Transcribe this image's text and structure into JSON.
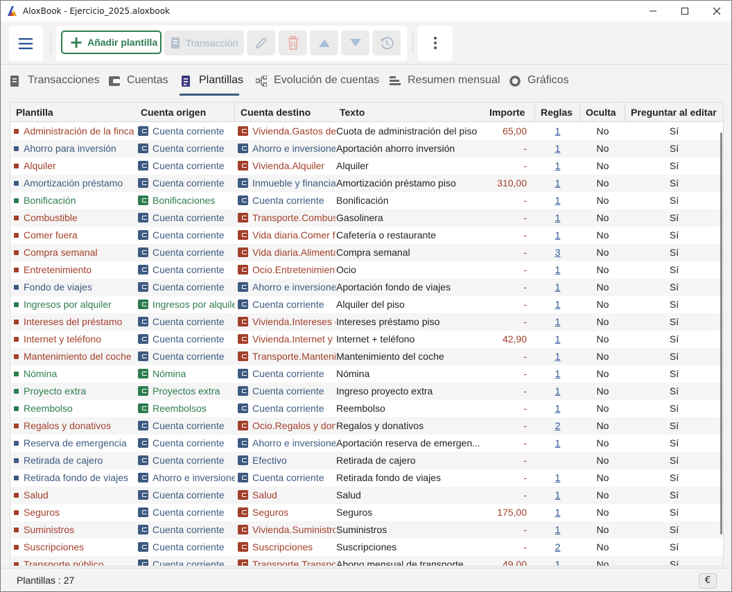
{
  "window": {
    "title": "AloxBook - Ejercicio_2025.aloxbook"
  },
  "toolbar": {
    "add_label": "Añadir plantilla",
    "transaction_label": "Transacción"
  },
  "tabs": [
    {
      "label": "Transacciones",
      "icon": "list-icon"
    },
    {
      "label": "Cuentas",
      "icon": "wallet-icon"
    },
    {
      "label": "Plantillas",
      "icon": "document-icon"
    },
    {
      "label": "Evolución de cuentas",
      "icon": "flow-icon"
    },
    {
      "label": "Resumen mensual",
      "icon": "summary-icon"
    },
    {
      "label": "Gráficos",
      "icon": "circle-icon"
    }
  ],
  "active_tab": "Plantillas",
  "columns": [
    "Plantilla",
    "Cuenta origen",
    "Cuenta destino",
    "Texto",
    "Importe",
    "Reglas",
    "Oculta",
    "Preguntar al editar"
  ],
  "rows": [
    {
      "plantilla": "Administración de la finca",
      "ptype": "red",
      "origen": "Cuenta corriente",
      "otype": "blue",
      "destino": "Vivienda.Gastos de comunidad",
      "dtype": "red",
      "texto": "Cuota de administración del piso",
      "importe": "65,00",
      "reglas": "1",
      "oculta": "No",
      "preguntar": "Sí"
    },
    {
      "plantilla": "Ahorro para inversión",
      "ptype": "blue",
      "origen": "Cuenta corriente",
      "otype": "blue",
      "destino": "Ahorro e inversiones",
      "dtype": "blue",
      "texto": "Aportación ahorro inversión",
      "importe": "-",
      "reglas": "1",
      "oculta": "No",
      "preguntar": "Sí"
    },
    {
      "plantilla": "Alquiler",
      "ptype": "red",
      "origen": "Cuenta corriente",
      "otype": "blue",
      "destino": "Vivienda.Alquiler",
      "dtype": "red",
      "texto": "Alquiler",
      "importe": "-",
      "reglas": "1",
      "oculta": "No",
      "preguntar": "Sí"
    },
    {
      "plantilla": "Amortización préstamo",
      "ptype": "blue",
      "origen": "Cuenta corriente",
      "otype": "blue",
      "destino": "Inmueble y financiación",
      "dtype": "blue",
      "texto": "Amortización préstamo piso",
      "importe": "310,00",
      "reglas": "1",
      "oculta": "No",
      "preguntar": "Sí"
    },
    {
      "plantilla": "Bonificación",
      "ptype": "green",
      "origen": "Bonificaciones",
      "otype": "green",
      "destino": "Cuenta corriente",
      "dtype": "blue",
      "texto": "Bonificación",
      "importe": "-",
      "reglas": "1",
      "oculta": "No",
      "preguntar": "Sí"
    },
    {
      "plantilla": "Combustible",
      "ptype": "red",
      "origen": "Cuenta corriente",
      "otype": "blue",
      "destino": "Transporte.Combustible",
      "dtype": "red",
      "texto": "Gasolinera",
      "importe": "-",
      "reglas": "1",
      "oculta": "No",
      "preguntar": "Sí"
    },
    {
      "plantilla": "Comer fuera",
      "ptype": "red",
      "origen": "Cuenta corriente",
      "otype": "blue",
      "destino": "Vida diaria.Comer fuera",
      "dtype": "red",
      "texto": "Cafetería o restaurante",
      "importe": "-",
      "reglas": "1",
      "oculta": "No",
      "preguntar": "Sí"
    },
    {
      "plantilla": "Compra semanal",
      "ptype": "red",
      "origen": "Cuenta corriente",
      "otype": "blue",
      "destino": "Vida diaria.Alimentación",
      "dtype": "red",
      "texto": "Compra semanal",
      "importe": "-",
      "reglas": "3",
      "oculta": "No",
      "preguntar": "Sí"
    },
    {
      "plantilla": "Entretenimiento",
      "ptype": "red",
      "origen": "Cuenta corriente",
      "otype": "blue",
      "destino": "Ocio.Entretenimiento",
      "dtype": "red",
      "texto": "Ocio",
      "importe": "-",
      "reglas": "1",
      "oculta": "No",
      "preguntar": "Sí"
    },
    {
      "plantilla": "Fondo de viajes",
      "ptype": "blue",
      "origen": "Cuenta corriente",
      "otype": "blue",
      "destino": "Ahorro e inversiones",
      "dtype": "blue",
      "texto": "Aportación fondo de viajes",
      "importe": "-",
      "reglas": "1",
      "oculta": "No",
      "preguntar": "Sí"
    },
    {
      "plantilla": "Ingresos por alquiler",
      "ptype": "green",
      "origen": "Ingresos por alquiler",
      "otype": "green",
      "destino": "Cuenta corriente",
      "dtype": "blue",
      "texto": "Alquiler del piso",
      "importe": "-",
      "reglas": "1",
      "oculta": "No",
      "preguntar": "Sí"
    },
    {
      "plantilla": "Intereses del préstamo",
      "ptype": "red",
      "origen": "Cuenta corriente",
      "otype": "blue",
      "destino": "Vivienda.Intereses del préstamo",
      "dtype": "red",
      "texto": "Intereses préstamo piso",
      "importe": "-",
      "reglas": "1",
      "oculta": "No",
      "preguntar": "Sí"
    },
    {
      "plantilla": "Internet y teléfono",
      "ptype": "red",
      "origen": "Cuenta corriente",
      "otype": "blue",
      "destino": "Vivienda.Internet y teléfono",
      "dtype": "red",
      "texto": "Internet + teléfono",
      "importe": "42,90",
      "reglas": "1",
      "oculta": "No",
      "preguntar": "Sí"
    },
    {
      "plantilla": "Mantenimiento del coche",
      "ptype": "red",
      "origen": "Cuenta corriente",
      "otype": "blue",
      "destino": "Transporte.Mantenimiento",
      "dtype": "red",
      "texto": "Mantenimiento del coche",
      "importe": "-",
      "reglas": "1",
      "oculta": "No",
      "preguntar": "Sí"
    },
    {
      "plantilla": "Nómina",
      "ptype": "green",
      "origen": "Nómina",
      "otype": "green",
      "destino": "Cuenta corriente",
      "dtype": "blue",
      "texto": "Nómina",
      "importe": "-",
      "reglas": "1",
      "oculta": "No",
      "preguntar": "Sí"
    },
    {
      "plantilla": "Proyecto extra",
      "ptype": "green",
      "origen": "Proyectos extra",
      "otype": "green",
      "destino": "Cuenta corriente",
      "dtype": "blue",
      "texto": "Ingreso proyecto extra",
      "importe": "-",
      "reglas": "1",
      "oculta": "No",
      "preguntar": "Sí"
    },
    {
      "plantilla": "Reembolso",
      "ptype": "green",
      "origen": "Reembolsos",
      "otype": "green",
      "destino": "Cuenta corriente",
      "dtype": "blue",
      "texto": "Reembolso",
      "importe": "-",
      "reglas": "1",
      "oculta": "No",
      "preguntar": "Sí"
    },
    {
      "plantilla": "Regalos y donativos",
      "ptype": "red",
      "origen": "Cuenta corriente",
      "otype": "blue",
      "destino": "Ocio.Regalos y donativos",
      "dtype": "red",
      "texto": "Regalos y donativos",
      "importe": "-",
      "reglas": "2",
      "oculta": "No",
      "preguntar": "Sí"
    },
    {
      "plantilla": "Reserva de emergencia",
      "ptype": "blue",
      "origen": "Cuenta corriente",
      "otype": "blue",
      "destino": "Ahorro e inversiones",
      "dtype": "blue",
      "texto": "Aportación reserva de emergen...",
      "importe": "-",
      "reglas": "1",
      "oculta": "No",
      "preguntar": "Sí"
    },
    {
      "plantilla": "Retirada de cajero",
      "ptype": "blue",
      "origen": "Cuenta corriente",
      "otype": "blue",
      "destino": "Efectivo",
      "dtype": "blue",
      "texto": "Retirada de cajero",
      "importe": "-",
      "reglas": "",
      "oculta": "No",
      "preguntar": "Sí"
    },
    {
      "plantilla": "Retirada fondo de viajes",
      "ptype": "blue",
      "origen": "Ahorro e inversiones",
      "otype": "blue",
      "destino": "Cuenta corriente",
      "dtype": "blue",
      "texto": "Retirada fondo de viajes",
      "importe": "-",
      "reglas": "1",
      "oculta": "No",
      "preguntar": "Sí"
    },
    {
      "plantilla": "Salud",
      "ptype": "red",
      "origen": "Cuenta corriente",
      "otype": "blue",
      "destino": "Salud",
      "dtype": "red",
      "texto": "Salud",
      "importe": "-",
      "reglas": "1",
      "oculta": "No",
      "preguntar": "Sí"
    },
    {
      "plantilla": "Seguros",
      "ptype": "red",
      "origen": "Cuenta corriente",
      "otype": "blue",
      "destino": "Seguros",
      "dtype": "red",
      "texto": "Seguros",
      "importe": "175,00",
      "reglas": "1",
      "oculta": "No",
      "preguntar": "Sí"
    },
    {
      "plantilla": "Suministros",
      "ptype": "red",
      "origen": "Cuenta corriente",
      "otype": "blue",
      "destino": "Vivienda.Suministros",
      "dtype": "red",
      "texto": "Suministros",
      "importe": "-",
      "reglas": "1",
      "oculta": "No",
      "preguntar": "Sí"
    },
    {
      "plantilla": "Suscripciones",
      "ptype": "red",
      "origen": "Cuenta corriente",
      "otype": "blue",
      "destino": "Suscripciones",
      "dtype": "red",
      "texto": "Suscripciones",
      "importe": "-",
      "reglas": "2",
      "oculta": "No",
      "preguntar": "Sí"
    },
    {
      "plantilla": "Transporte público",
      "ptype": "red",
      "origen": "Cuenta corriente",
      "otype": "blue",
      "destino": "Transporte.Transporte público",
      "dtype": "red",
      "texto": "Abono mensual de transporte",
      "importe": "49,00",
      "reglas": "1",
      "oculta": "No",
      "preguntar": "Sí"
    }
  ],
  "footer": {
    "count_label": "Plantillas : 27",
    "currency_button": "€"
  },
  "colors": {
    "expense": "#a3402b",
    "transfer": "#3d5a80",
    "income": "#2e7d4f",
    "link": "#2b5797"
  }
}
